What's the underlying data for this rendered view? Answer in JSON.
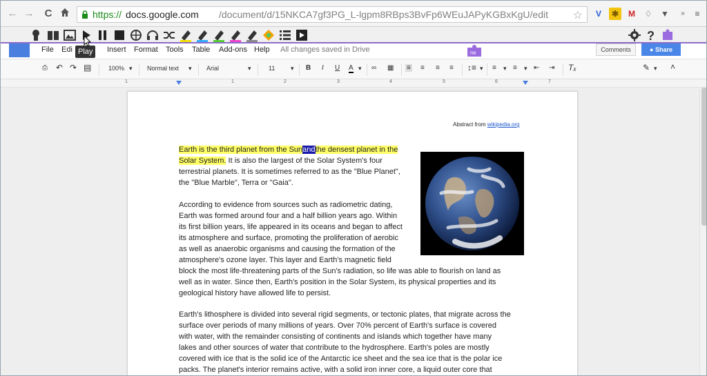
{
  "browser": {
    "url_scheme": "https://",
    "url_host": "docs.google.com",
    "url_path": "/document/d/15NKCA7gf3PG_L-lgpm8RBps3BvFp6WEuJAPyKGBxKgU/edit"
  },
  "rw_toolbar": {
    "play_tooltip": "Play",
    "floating_label": "rw"
  },
  "menubar": {
    "items": [
      "File",
      "Edi",
      "Insert",
      "Format",
      "Tools",
      "Table",
      "Add-ons",
      "Help"
    ],
    "saved_status": "All changes saved in Drive",
    "comments_label": "Comments",
    "share_label": "Share"
  },
  "format_toolbar": {
    "zoom": "100%",
    "style": "Normal text",
    "font": "Arial",
    "size": "11",
    "bold": "B",
    "italic": "I",
    "underline": "U",
    "text_color": "A"
  },
  "ruler": {
    "numbers": [
      "1",
      "1",
      "2",
      "3",
      "4",
      "5",
      "6",
      "7"
    ]
  },
  "document": {
    "abstract_prefix": "Abstract from ",
    "abstract_link": "wikipedia.org",
    "p1_hl1": "Earth is the third planet from the Sun",
    "p1_sel": "and",
    "p1_hl2": "the densest planet in the",
    "p1_hl3": "Solar System.",
    "p1_rest1": " It is also the largest of the Solar System's four",
    "p1_line3": "terrestrial planets. It is sometimes referred to as the \"Blue Planet\",",
    "p1_line4": "the \"Blue Marble\", Terra or \"Gaia\".",
    "p2_lines": [
      "According to evidence from sources such as radiometric dating,",
      "Earth was formed around four and a half billion years ago. Within",
      "its first billion years, life appeared in its oceans and began to affect",
      "its atmosphere and surface, promoting the proliferation of aerobic",
      "as well as anaerobic organisms and causing the formation of the",
      "atmosphere's ozone layer. This layer and Earth's magnetic field",
      "block the most life-threatening parts of the Sun's radiation, so life was able to flourish on land as",
      "well as in water. Since then, Earth's position in the Solar System, its physical properties and its",
      "geological history have allowed life to persist."
    ],
    "p3_lines": [
      "Earth's lithosphere is divided into several rigid segments, or tectonic plates, that migrate across the",
      "surface over periods of many millions of years. Over 70% percent of Earth's surface is covered",
      "with water, with the remainder consisting of continents and islands which together have many",
      "lakes and other sources of water that contribute to the hydrosphere. Earth's poles are mostly",
      "covered with ice that is the solid ice of the Antarctic ice sheet and the sea ice that is the polar ice",
      "packs. The planet's interior remains active, with a solid iron inner core, a liquid outer core that"
    ]
  },
  "colors": {
    "highlight": "#ffff66",
    "selection": "#1a1aaa",
    "accent": "#8a6cc8",
    "share": "#4a86e8"
  }
}
